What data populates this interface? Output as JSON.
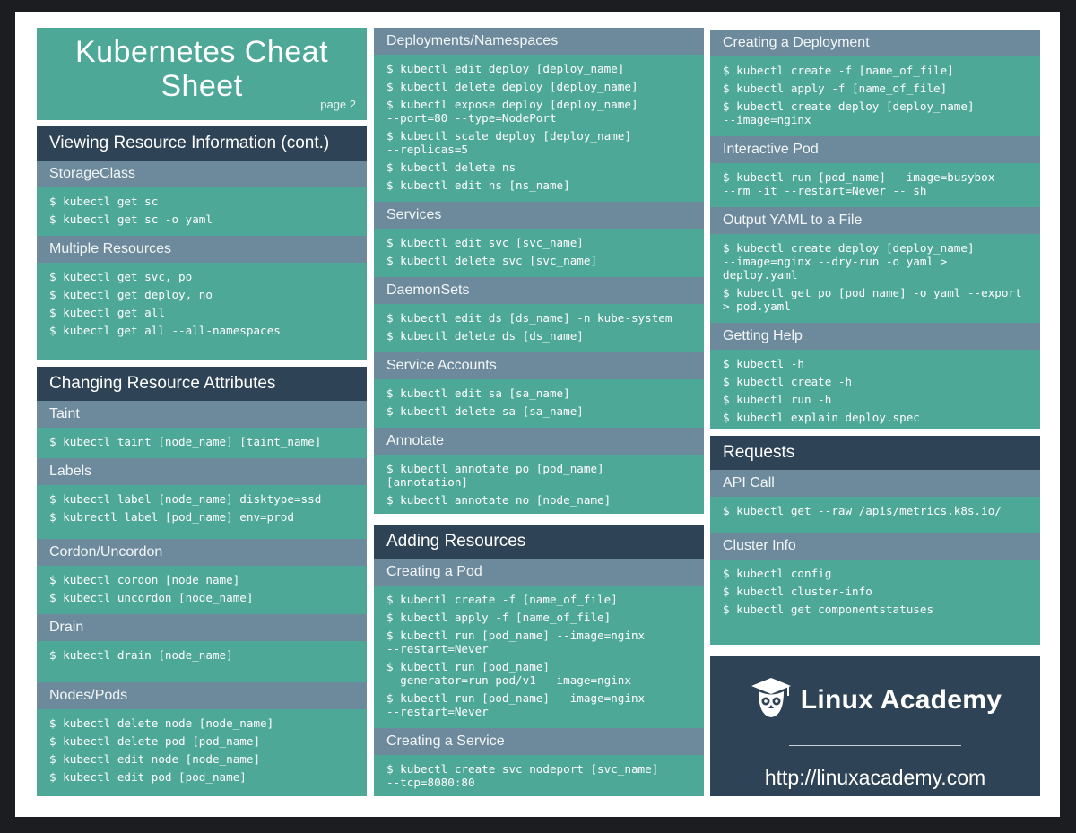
{
  "title": {
    "line1": "Kubernetes Cheat",
    "line2": "Sheet",
    "page": "page 2"
  },
  "viewing": {
    "header": "Viewing Resource Information (cont.)",
    "storageclass": {
      "title": "StorageClass",
      "cmds": [
        "$ kubectl get sc",
        "$ kubectl get sc -o yaml"
      ]
    },
    "multiple": {
      "title": "Multiple Resources",
      "cmds": [
        "$ kubectl get svc, po",
        "$ kubectl get deploy, no",
        "$ kubectl get all",
        "$ kubectl get all --all-namespaces"
      ]
    }
  },
  "changing": {
    "header": "Changing Resource Attributes",
    "taint": {
      "title": "Taint",
      "cmds": [
        "$ kubectl taint [node_name] [taint_name]"
      ]
    },
    "labels": {
      "title": "Labels",
      "cmds": [
        "$ kubectl label [node_name] disktype=ssd",
        "$ kubrectl label [pod_name] env=prod"
      ]
    },
    "cordon": {
      "title": "Cordon/Uncordon",
      "cmds": [
        "$ kubectl cordon [node_name]",
        "$ kubectl uncordon [node_name]"
      ]
    },
    "drain": {
      "title": "Drain",
      "cmds": [
        "$ kubectl drain [node_name]"
      ]
    },
    "nodespods": {
      "title": "Nodes/Pods",
      "cmds": [
        "$ kubectl delete node [node_name]",
        "$ kubectl delete pod [pod_name]",
        "$ kubectl edit node [node_name]",
        "$ kubectl edit pod [pod_name]"
      ]
    }
  },
  "deployments": {
    "title": "Deployments/Namespaces",
    "cmds": [
      "$ kubectl edit deploy [deploy_name]",
      "$ kubectl delete deploy [deploy_name]",
      "$ kubectl expose deploy [deploy_name]\n--port=80 --type=NodePort",
      "$ kubectl scale deploy [deploy_name]\n--replicas=5",
      "$ kubectl delete ns",
      "$ kubectl edit ns [ns_name]"
    ]
  },
  "services": {
    "title": "Services",
    "cmds": [
      "$ kubectl edit svc [svc_name]",
      "$ kubectl delete svc [svc_name]"
    ]
  },
  "daemonsets": {
    "title": "DaemonSets",
    "cmds": [
      "$ kubectl edit ds [ds_name] -n kube-system",
      "$ kubectl delete ds [ds_name]"
    ]
  },
  "serviceaccounts": {
    "title": "Service Accounts",
    "cmds": [
      "$ kubectl edit sa [sa_name]",
      "$ kubectl delete sa [sa_name]"
    ]
  },
  "annotate": {
    "title": "Annotate",
    "cmds": [
      "$ kubectl annotate po [pod_name]\n[annotation]",
      "$ kubectl annotate no [node_name]"
    ]
  },
  "adding": {
    "header": "Adding Resources",
    "pod": {
      "title": "Creating a Pod",
      "cmds": [
        "$ kubectl create -f [name_of_file]",
        "$ kubectl apply -f [name_of_file]",
        "$ kubectl run [pod_name] --image=nginx\n--restart=Never",
        "$ kubectl run [pod_name]\n--generator=run-pod/v1 --image=nginx",
        "$ kubectl run [pod_name] --image=nginx\n--restart=Never"
      ]
    },
    "service": {
      "title": "Creating a Service",
      "cmds": [
        "$ kubectl create svc nodeport [svc_name]\n--tcp=8080:80"
      ]
    }
  },
  "creatingdeploy": {
    "title": "Creating a Deployment",
    "cmds": [
      "$ kubectl create -f [name_of_file]",
      "$ kubectl apply -f [name_of_file]",
      "$ kubectl create deploy [deploy_name]\n--image=nginx"
    ]
  },
  "interactive": {
    "title": "Interactive Pod",
    "cmds": [
      "$ kubectl run [pod_name] --image=busybox\n--rm -it --restart=Never -- sh"
    ]
  },
  "outputyaml": {
    "title": "Output YAML to a File",
    "cmds": [
      "$ kubectl create deploy [deploy_name]\n--image=nginx --dry-run -o yaml >\ndeploy.yaml",
      "$ kubectl get po [pod_name] -o yaml --export\n> pod.yaml"
    ]
  },
  "help": {
    "title": "Getting Help",
    "cmds": [
      "$ kubectl -h",
      "$ kubectl create -h",
      "$ kubectl run -h",
      "$ kubectl explain deploy.spec"
    ]
  },
  "requests": {
    "header": "Requests",
    "api": {
      "title": "API Call",
      "cmds": [
        "$ kubectl get --raw /apis/metrics.k8s.io/"
      ]
    },
    "cluster": {
      "title": "Cluster Info",
      "cmds": [
        "$ kubectl config",
        "$ kubectl cluster-info",
        "$ kubectl get componentstatuses"
      ]
    }
  },
  "logo": {
    "brand": "Linux Academy",
    "url": "http://linuxacademy.com",
    "icon": "owl-graduation-cap-icon"
  },
  "colors": {
    "teal": "#4ea898",
    "navy": "#2e4356",
    "slate": "#6d8a9c"
  }
}
